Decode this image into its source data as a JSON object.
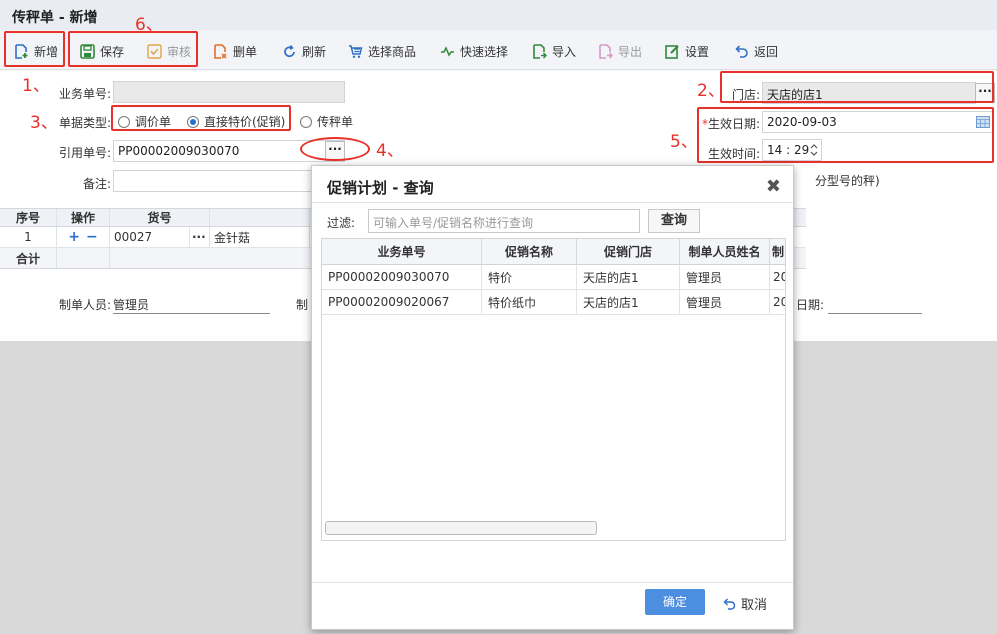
{
  "title": "传秤单 - 新增",
  "toolbar": {
    "new": "新增",
    "save": "保存",
    "audit": "审核",
    "delete": "删单",
    "refresh": "刷新",
    "select_goods": "选择商品",
    "quick_select": "快速选择",
    "import": "导入",
    "export": "导出",
    "settings": "设置",
    "back": "返回"
  },
  "colors": {
    "accent": "#4c8ee0",
    "annotation": "#e8312a",
    "icon_green": "#2f8a3b"
  },
  "annotations": [
    "1、",
    "2、",
    "3、",
    "4、",
    "5、",
    "6、"
  ],
  "form": {
    "doc_no_label": "业务单号:",
    "doc_no_value": "",
    "doc_type_label": "单据类型:",
    "radio_price_adjust": "调价单",
    "radio_direct_special": "直接特价(促销)",
    "radio_transfer_scale": "传秤单",
    "ref_no_label": "引用单号:",
    "ref_no_value": "PP00002009030070",
    "ref_no_button": "···",
    "remark_label": "备注:",
    "remark_value": "",
    "store_label": "门店:",
    "store_value": "天店的店1",
    "store_button": "···",
    "effective_date_label": "生效日期:",
    "effective_date_required": "*",
    "effective_date_value": "2020-09-03",
    "effective_time_label": "生效时间:",
    "effective_time_value": "14 : 29",
    "hint_fragment": "分型号的秤)"
  },
  "grid": {
    "headers": {
      "seq": "序号",
      "action": "操作",
      "goods_no": "货号"
    },
    "row": {
      "seq": "1",
      "add": "+",
      "remove": "−",
      "goods_no": "00027",
      "dots": "···",
      "goods_name": "金针菇"
    },
    "sum_label": "合计"
  },
  "footer": {
    "maker_label": "制单人员:",
    "maker_value": "管理员",
    "maker2_label": "制",
    "date_label": "日期:"
  },
  "modal": {
    "title": "促销计划 - 查询",
    "close": "✖",
    "filter_label": "过滤:",
    "filter_placeholder": "可输入单号/促销名称进行查询",
    "search_button": "查询",
    "columns": [
      "业务单号",
      "促销名称",
      "促销门店",
      "制单人员姓名",
      "制"
    ],
    "rows": [
      [
        "PP00002009030070",
        "特价",
        "天店的店1",
        "管理员",
        "20"
      ],
      [
        "PP00002009020067",
        "特价纸巾",
        "天店的店1",
        "管理员",
        "20"
      ]
    ],
    "ok_button": "确定",
    "cancel_button": "取消"
  }
}
